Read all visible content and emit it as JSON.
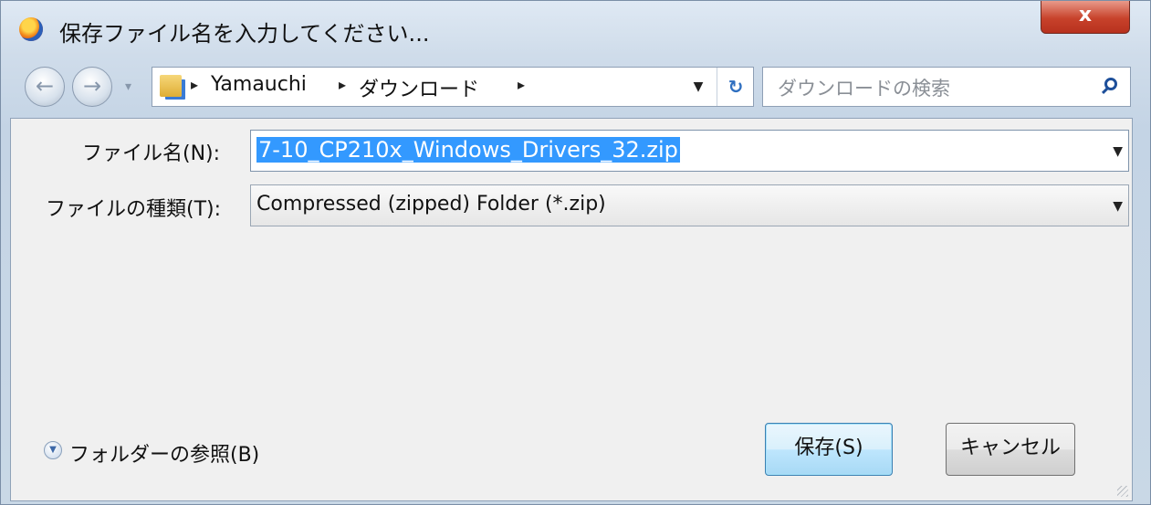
{
  "window": {
    "title": "保存ファイル名を入力してください...",
    "close_label": "x"
  },
  "navigation": {
    "breadcrumb": [
      "Yamauchi",
      "ダウンロード"
    ],
    "search_placeholder": "ダウンロードの検索"
  },
  "form": {
    "filename_label": "ファイル名(N):",
    "filename_value": "7-10_CP210x_Windows_Drivers_32.zip",
    "filetype_label": "ファイルの種類(T):",
    "filetype_value": "Compressed (zipped) Folder (*.zip)"
  },
  "footer": {
    "browse_folders_label": "フォルダーの参照(B)",
    "save_label": "保存(S)",
    "cancel_label": "キャンセル"
  },
  "colors": {
    "selection": "#3399ff",
    "close_button": "#c7422b"
  },
  "icons": [
    "firefox-icon",
    "back-arrow-icon",
    "forward-arrow-icon",
    "folder-icon",
    "refresh-icon",
    "search-icon",
    "chevron-down-icon"
  ]
}
